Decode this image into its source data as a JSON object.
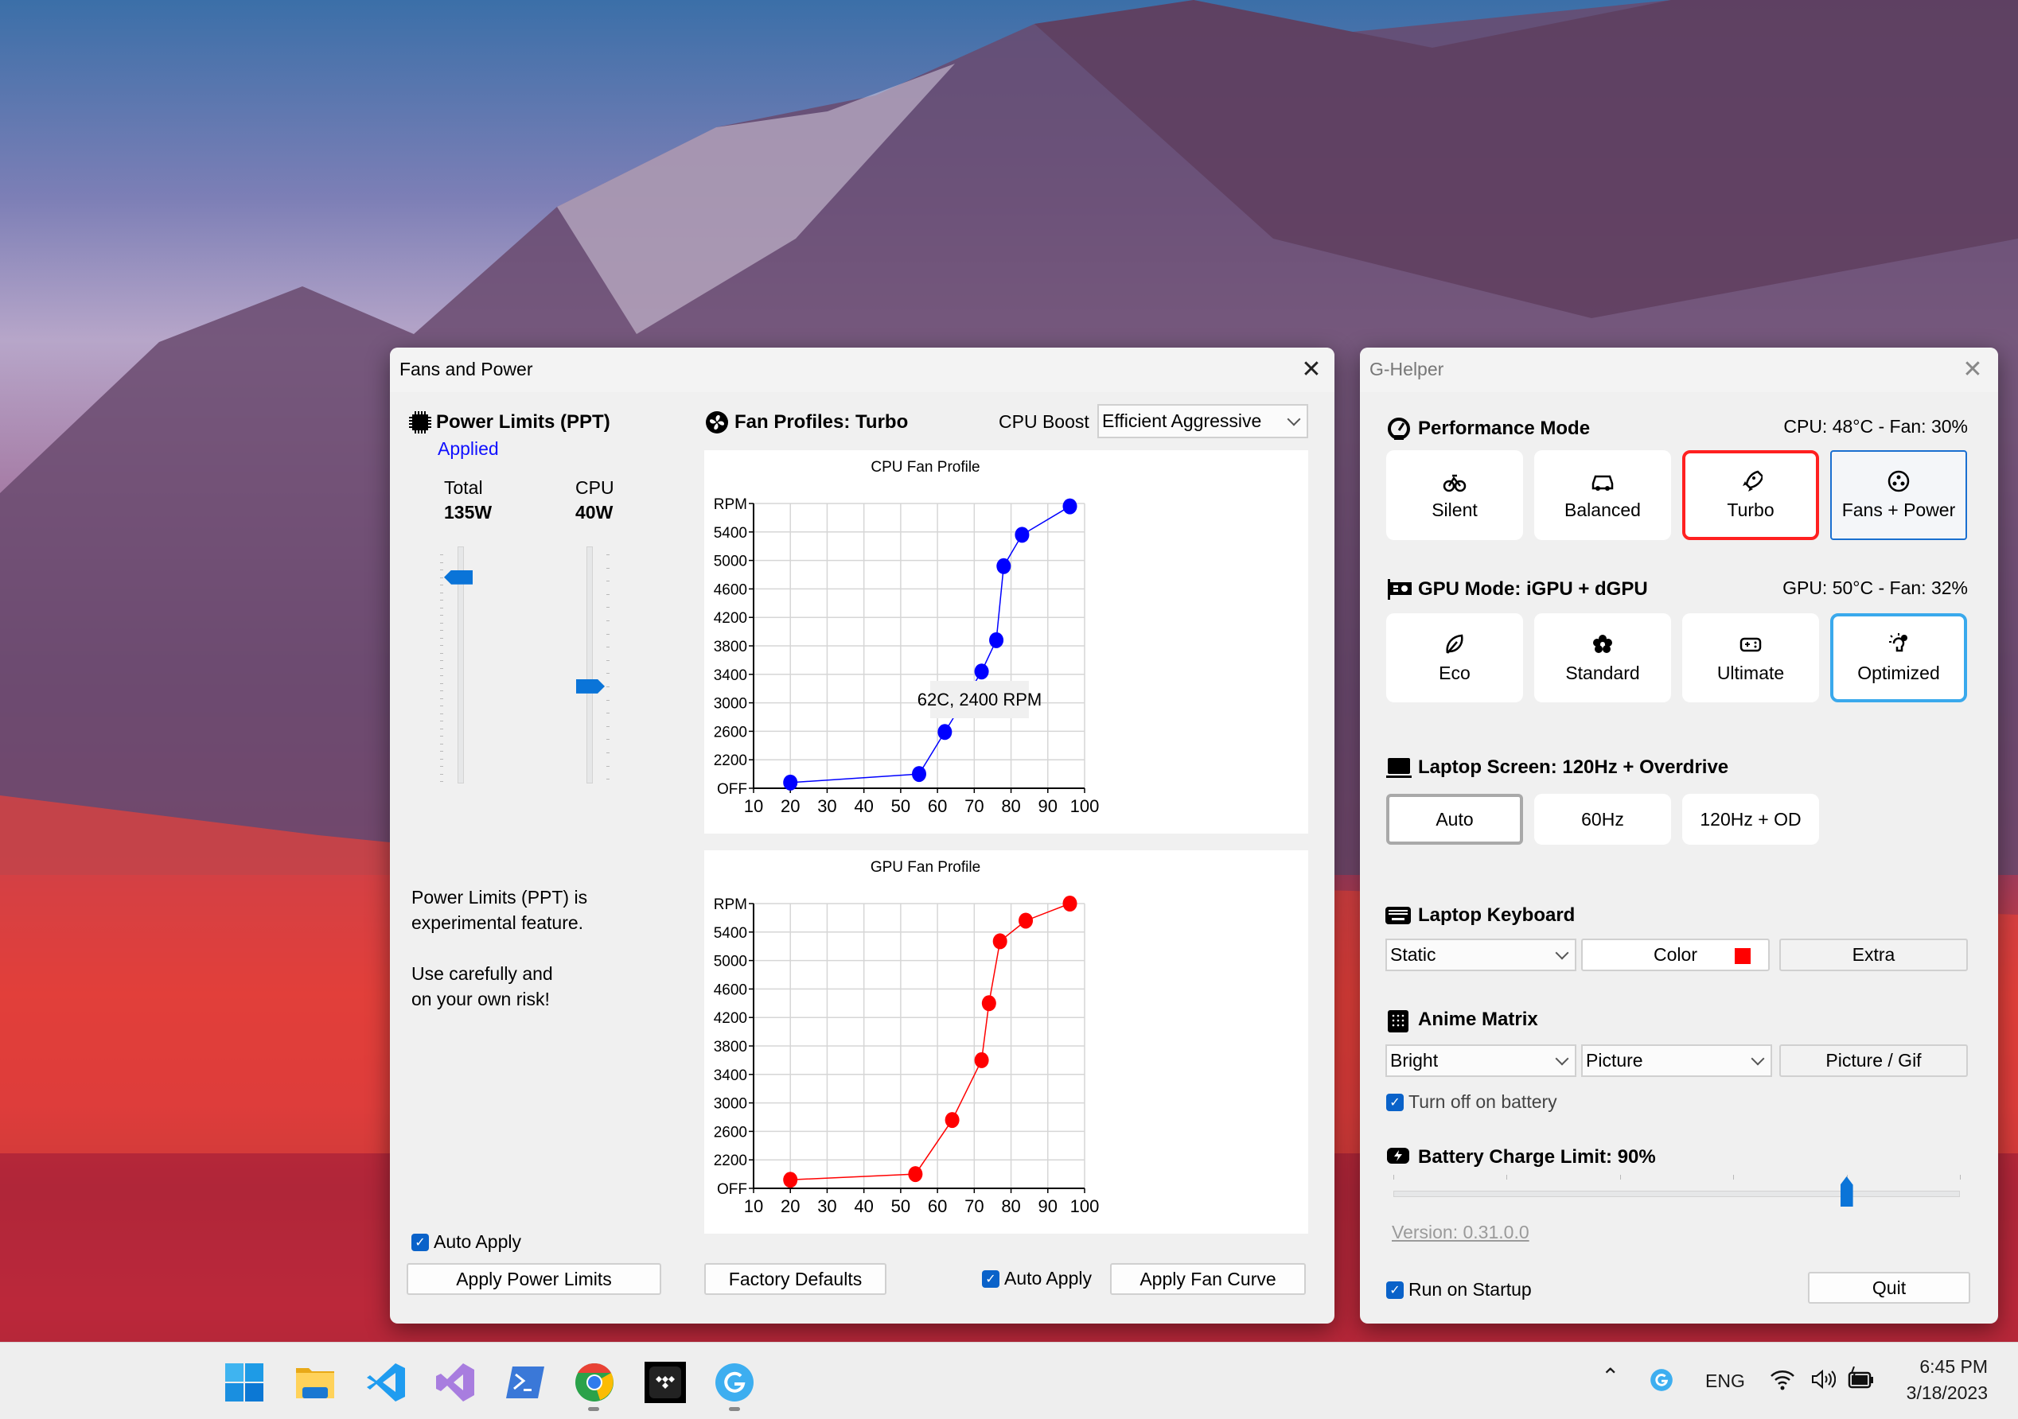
{
  "fans_window": {
    "title": "Fans and Power",
    "close_icon": "close-icon",
    "ppt": {
      "icon": "cpu-chip-icon",
      "title": "Power Limits (PPT)",
      "status": "Applied",
      "status_color": "#1010ff",
      "total": {
        "label": "Total",
        "value": "135W",
        "slider_level": 0.87
      },
      "cpu": {
        "label": "CPU",
        "value": "40W",
        "slider_level": 0.41
      },
      "warning_line1": "Power Limits (PPT) is",
      "warning_line2": "experimental feature.",
      "warning_line3": "Use carefully and",
      "warning_line4": "on your own risk!",
      "auto_apply": {
        "label": "Auto Apply",
        "checked": true
      },
      "apply_button": "Apply Power Limits"
    },
    "fans": {
      "icon": "fan-icon",
      "title": "Fan Profiles: Turbo",
      "cpu_boost_label": "CPU Boost",
      "cpu_boost_value": "Efficient Aggressive",
      "factory_defaults": "Factory Defaults",
      "auto_apply": {
        "label": "Auto Apply",
        "checked": true
      },
      "apply_button": "Apply Fan Curve"
    }
  },
  "chart_data": [
    {
      "type": "line",
      "title": "CPU Fan Profile",
      "color": "#0000ff",
      "x": [
        20,
        55,
        62,
        72,
        76,
        78,
        83,
        96
      ],
      "y": [
        1880,
        2000,
        2590,
        3440,
        3880,
        4920,
        5360,
        5760
      ],
      "xlim": [
        10,
        100
      ],
      "ylim": [
        1800,
        5800
      ],
      "x_ticks": [
        10,
        20,
        30,
        40,
        50,
        60,
        70,
        80,
        90,
        100
      ],
      "y_ticks": [
        1800,
        2200,
        2600,
        3000,
        3400,
        3800,
        4200,
        4600,
        5000,
        5400,
        5800
      ],
      "y_tick_labels": [
        "OFF",
        "2200",
        "2600",
        "3000",
        "3400",
        "3800",
        "4200",
        "4600",
        "5000",
        "5400",
        "RPM"
      ],
      "grid": true,
      "tooltip": "62C, 2400 RPM"
    },
    {
      "type": "line",
      "title": "GPU Fan Profile",
      "color": "#ff0000",
      "x": [
        20,
        54,
        64,
        72,
        74,
        77,
        84,
        96
      ],
      "y": [
        1920,
        2000,
        2760,
        3600,
        4400,
        5270,
        5560,
        5800
      ],
      "xlim": [
        10,
        100
      ],
      "ylim": [
        1800,
        5800
      ],
      "x_ticks": [
        10,
        20,
        30,
        40,
        50,
        60,
        70,
        80,
        90,
        100
      ],
      "y_ticks": [
        1800,
        2200,
        2600,
        3000,
        3400,
        3800,
        4200,
        4600,
        5000,
        5400,
        5800
      ],
      "y_tick_labels": [
        "OFF",
        "2200",
        "2600",
        "3000",
        "3400",
        "3800",
        "4200",
        "4600",
        "5000",
        "5400",
        "RPM"
      ],
      "grid": true
    }
  ],
  "ghelper": {
    "title": "G-Helper",
    "performance": {
      "icon": "gauge-icon",
      "title": "Performance Mode",
      "stats": "CPU: 48°C -  Fan: 30%",
      "modes": [
        {
          "label": "Silent",
          "icon": "bicycle-icon"
        },
        {
          "label": "Balanced",
          "icon": "car-icon"
        },
        {
          "label": "Turbo",
          "icon": "rocket-icon",
          "selected": true
        },
        {
          "label": "Fans + Power",
          "icon": "fan-icon"
        }
      ],
      "selected_color": "#ff2020"
    },
    "gpu": {
      "icon": "gpu-card-icon",
      "title": "GPU Mode: iGPU + dGPU",
      "stats": "GPU: 50°C -  Fan: 32%",
      "modes": [
        {
          "label": "Eco",
          "icon": "leaf-icon"
        },
        {
          "label": "Standard",
          "icon": "flower-icon"
        },
        {
          "label": "Ultimate",
          "icon": "gamepad-icon"
        },
        {
          "label": "Optimized",
          "icon": "lightbulb-gear-icon",
          "selected": true
        }
      ],
      "selected_color": "#3aa9ec"
    },
    "screen": {
      "icon": "laptop-icon",
      "title": "Laptop Screen: 120Hz + Overdrive",
      "modes": [
        {
          "label": "Auto",
          "selected": true
        },
        {
          "label": "60Hz"
        },
        {
          "label": "120Hz + OD"
        }
      ]
    },
    "keyboard": {
      "icon": "keyboard-icon",
      "title": "Laptop Keyboard",
      "mode": "Static",
      "color_label": "Color",
      "color": "#ff0000",
      "extra": "Extra"
    },
    "anime": {
      "icon": "matrix-icon",
      "title": "Anime Matrix",
      "brightness": "Bright",
      "mode": "Picture",
      "picture_button": "Picture / Gif",
      "turn_off_battery": {
        "label": "Turn off on battery",
        "checked": true
      }
    },
    "battery": {
      "icon": "battery-charge-icon",
      "title": "Battery Charge Limit: 90%",
      "value": 90,
      "min": 50,
      "max": 100
    },
    "version": "Version: 0.31.0.0",
    "run_on_startup": {
      "label": "Run on Startup",
      "checked": true
    },
    "quit": "Quit"
  },
  "taskbar": {
    "apps": [
      "windows-start-icon",
      "file-explorer-icon",
      "vscode-icon",
      "visual-studio-icon",
      "powershell-icon",
      "chrome-icon",
      "tidal-icon",
      "g-helper-icon"
    ],
    "tray": {
      "language": "ENG",
      "time": "6:45 PM",
      "date": "3/18/2023"
    }
  }
}
